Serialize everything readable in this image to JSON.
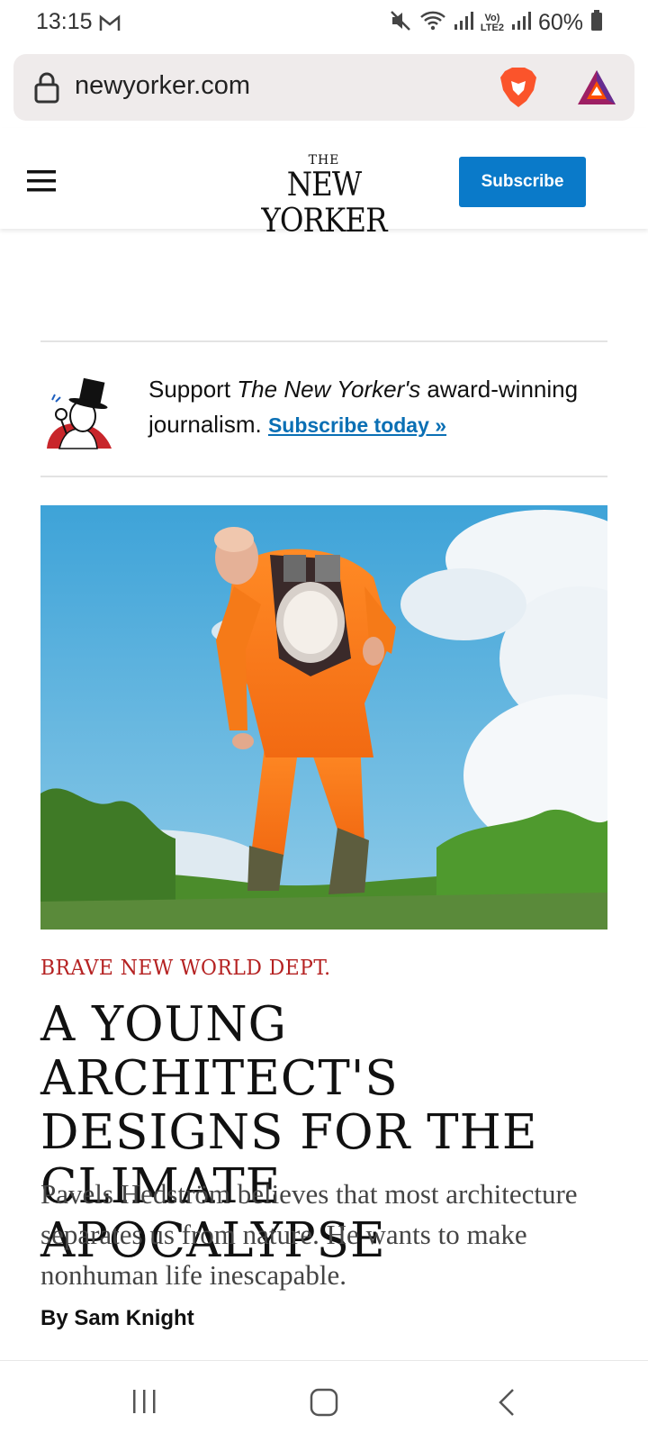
{
  "status_bar": {
    "time": "13:15",
    "battery_text": "60%",
    "network_label_top": "Vo)",
    "network_label_bottom": "LTE2",
    "icons": [
      "gmail-icon",
      "mute-icon",
      "wifi-icon",
      "signal-icon",
      "signal-icon",
      "battery-icon"
    ]
  },
  "browser": {
    "url": "newyorker.com",
    "icons": [
      "lock-icon",
      "brave-shields-icon",
      "bat-rewards-icon"
    ]
  },
  "site_header": {
    "logo_the": "THE",
    "logo_main": "NEW YORKER",
    "subscribe_label": "Subscribe"
  },
  "promo": {
    "text_before": "Support ",
    "text_italic": "The New Yorker's",
    "text_after": " award-winning journalism. ",
    "link_label": "Subscribe today »"
  },
  "article": {
    "rubric": "BRAVE NEW WORLD DEPT.",
    "headline": "A YOUNG ARCHITECT'S DESIGNS FOR THE CLIMATE APOCALYPSE",
    "dek": "Pavels Hedström believes that most architecture separates us from nature. He wants to make nonhuman life inescapable.",
    "byline_prefix": "By ",
    "byline_author": "Sam Knight"
  },
  "colors": {
    "subscribe_blue": "#0a7ac9",
    "link_blue": "#0a6fb4",
    "rubric_red": "#b52222",
    "suit_orange": "#ff7a1a"
  },
  "navbar": {
    "icons": [
      "recent-apps-icon",
      "home-icon",
      "back-icon"
    ]
  }
}
